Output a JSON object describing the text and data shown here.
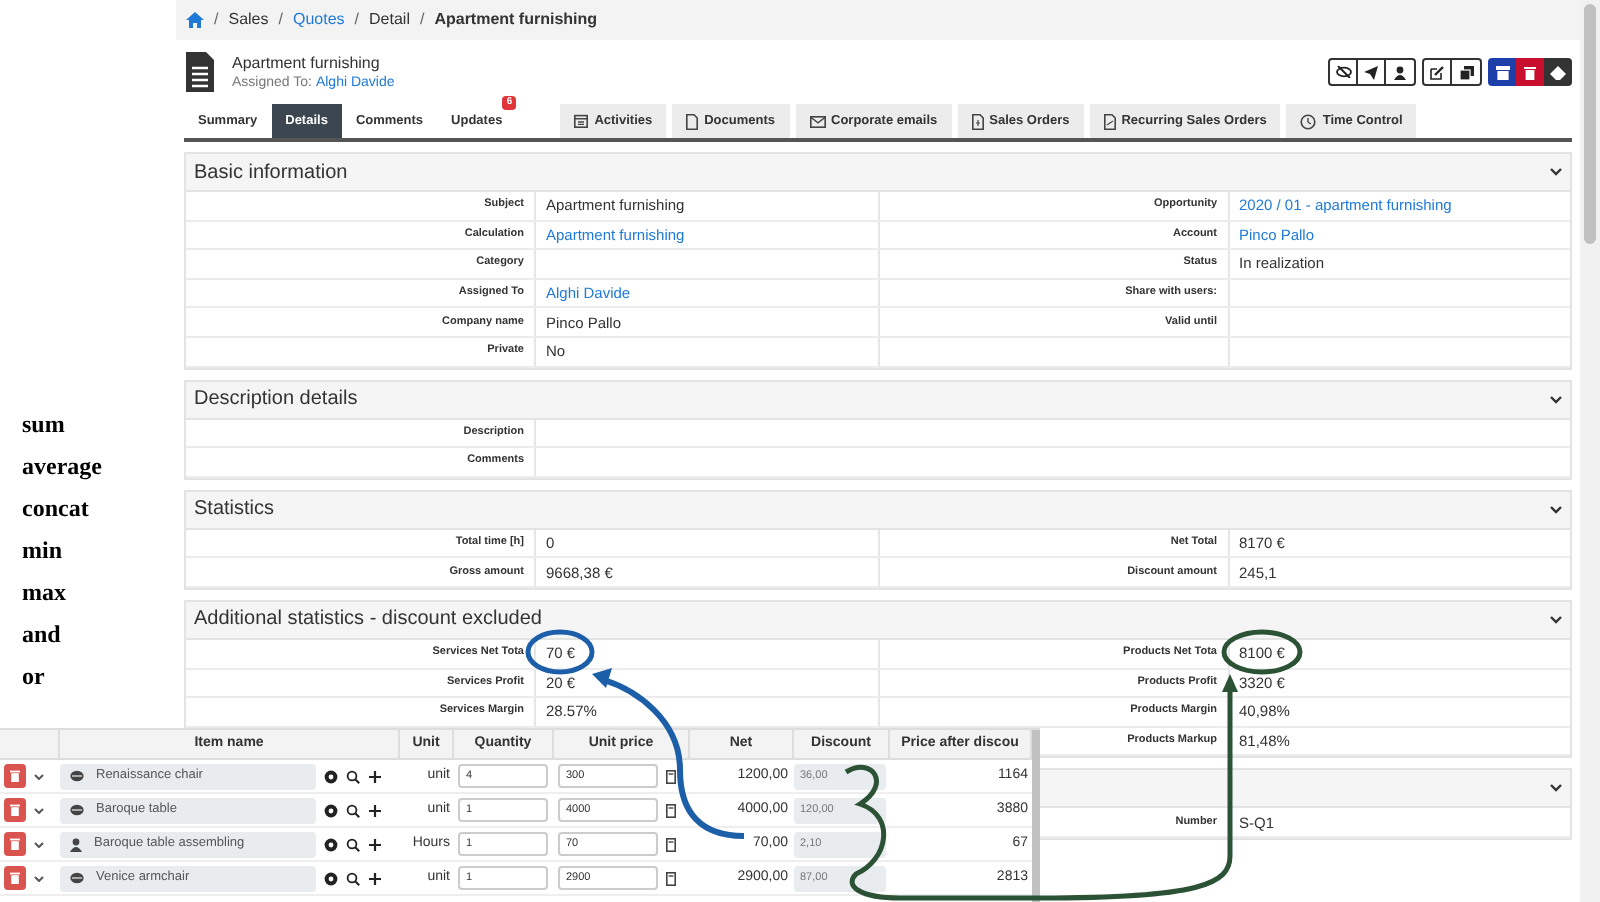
{
  "functions": [
    "sum",
    "average",
    "concat",
    "min",
    "max",
    "and",
    "or"
  ],
  "breadcrumb": {
    "separator": "/",
    "items": [
      {
        "label": "Sales",
        "link": false,
        "current": false
      },
      {
        "label": "Quotes",
        "link": true,
        "current": false
      },
      {
        "label": "Detail",
        "link": false,
        "current": false
      },
      {
        "label": "Apartment furnishing",
        "link": false,
        "current": true
      }
    ]
  },
  "record": {
    "title": "Apartment furnishing",
    "assigned_label": "Assigned To:",
    "assigned_value": "Alghi Davide"
  },
  "tabs": [
    {
      "label": "Summary",
      "kind": "view",
      "selected": false
    },
    {
      "label": "Details",
      "kind": "view",
      "selected": true
    },
    {
      "label": "Comments",
      "kind": "view",
      "selected": false
    },
    {
      "label": "Updates",
      "kind": "view",
      "selected": false,
      "badge": "6"
    },
    {
      "label": "Activities",
      "kind": "module",
      "selected": false
    },
    {
      "label": "Documents",
      "kind": "module",
      "selected": false
    },
    {
      "label": "Corporate emails",
      "kind": "module",
      "selected": false
    },
    {
      "label": "Sales Orders",
      "kind": "module",
      "selected": false
    },
    {
      "label": "Recurring Sales Orders",
      "kind": "module",
      "selected": false
    },
    {
      "label": "Time Control",
      "kind": "module",
      "selected": false
    }
  ],
  "sections": [
    {
      "title": "Basic information",
      "rows": [
        {
          "kind": "pair",
          "left": {
            "label": "Subject",
            "value": "Apartment furnishing",
            "link": false
          },
          "right": {
            "label": "Opportunity",
            "value": "2020 / 01 - apartment furnishing",
            "link": true
          }
        },
        {
          "kind": "pair",
          "left": {
            "label": "Calculation",
            "value": "Apartment furnishing",
            "link": true
          },
          "right": {
            "label": "Account",
            "value": "Pinco Pallo",
            "link": true
          }
        },
        {
          "kind": "pair",
          "left": {
            "label": "Category"
          },
          "right": {
            "label": "Status",
            "value": "In realization",
            "link": false
          }
        },
        {
          "kind": "pair",
          "left": {
            "label": "Assigned To",
            "value": "Alghi Davide",
            "link": true
          },
          "right": {
            "label": "Share with users:"
          }
        },
        {
          "kind": "pair",
          "left": {
            "label": "Company name",
            "value": "Pinco Pallo",
            "link": false
          },
          "right": {
            "label": "Valid until"
          }
        },
        {
          "kind": "pair",
          "left": {
            "label": "Private",
            "value": "No",
            "link": false
          },
          "right": {}
        }
      ]
    },
    {
      "title": "Description details",
      "rows": [
        {
          "kind": "single",
          "left": {
            "label": "Description"
          }
        },
        {
          "kind": "single",
          "left": {
            "label": "Comments"
          }
        }
      ]
    },
    {
      "title": "Statistics",
      "rows": [
        {
          "kind": "pair",
          "left": {
            "label": "Total time [h]",
            "value": "0",
            "link": false
          },
          "right": {
            "label": "Net Total",
            "value": "8170 €",
            "link": false
          }
        },
        {
          "kind": "pair",
          "left": {
            "label": "Gross amount",
            "value": "9668,38 €",
            "link": false
          },
          "right": {
            "label": "Discount amount",
            "value": "245,1",
            "link": false
          }
        }
      ]
    },
    {
      "title": "Additional statistics - discount excluded",
      "rows": [
        {
          "kind": "pair",
          "left": {
            "label": "Services Net Tota",
            "value": "70 €",
            "link": false
          },
          "right": {
            "label": "Products Net Tota",
            "value": "8100 €",
            "link": false
          }
        },
        {
          "kind": "pair",
          "left": {
            "label": "Services Profit",
            "value": "20 €",
            "link": false
          },
          "right": {
            "label": "Products Profit",
            "value": "3320 €",
            "link": false
          }
        },
        {
          "kind": "pair",
          "left": {
            "label": "Services Margin",
            "value": "28.57%",
            "link": false
          },
          "right": {
            "label": "Products Margin",
            "value": "40,98%",
            "link": false
          }
        },
        {
          "kind": "pair",
          "left": {},
          "right": {
            "label": "Products Markup",
            "value": "81,48%",
            "link": false
          }
        }
      ]
    },
    {
      "rows": [
        {
          "kind": "pair",
          "left": {},
          "right": {
            "label": "Number",
            "value": "S-Q1",
            "link": false
          }
        }
      ]
    }
  ],
  "inventory": {
    "columns": [
      "Item name",
      "Unit",
      "Quantity",
      "Unit price",
      "Net",
      "Discount",
      "Price after discou"
    ],
    "rows": [
      {
        "kind": "product",
        "name": "Renaissance chair",
        "unit": "unit",
        "quantity": "4",
        "unit_price": "300",
        "net": "1200,00",
        "discount": "36,00",
        "price_after": "1164"
      },
      {
        "kind": "product",
        "name": "Baroque table",
        "unit": "unit",
        "quantity": "1",
        "unit_price": "4000",
        "net": "4000,00",
        "discount": "120,00",
        "price_after": "3880"
      },
      {
        "kind": "service",
        "name": "Baroque table assembling",
        "unit": "Hours",
        "quantity": "1",
        "unit_price": "70",
        "net": "70,00",
        "discount": "2,10",
        "price_after": "67"
      },
      {
        "kind": "product",
        "name": "Venice armchair",
        "unit": "unit",
        "quantity": "1",
        "unit_price": "2900",
        "net": "2900,00",
        "discount": "87,00",
        "price_after": "2813"
      }
    ]
  }
}
